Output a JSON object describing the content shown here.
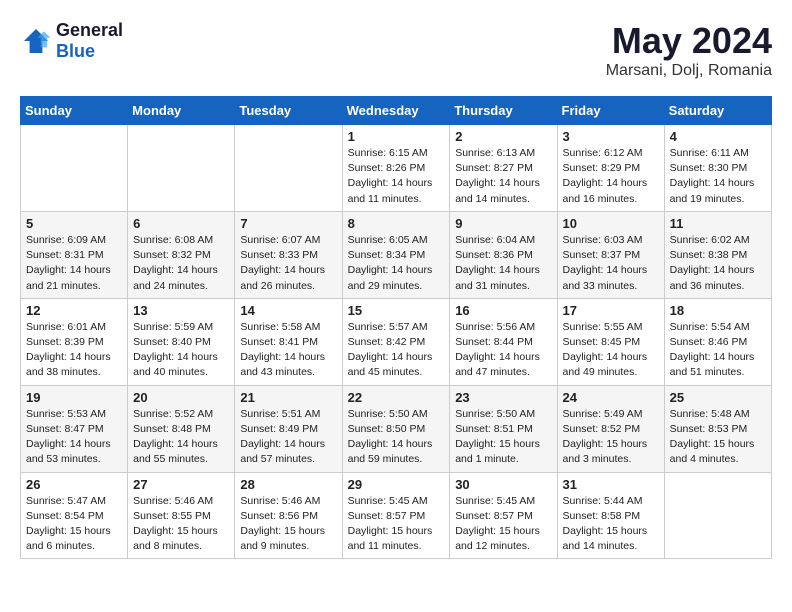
{
  "header": {
    "logo_line1": "General",
    "logo_line2": "Blue",
    "title": "May 2024",
    "subtitle": "Marsani, Dolj, Romania"
  },
  "weekdays": [
    "Sunday",
    "Monday",
    "Tuesday",
    "Wednesday",
    "Thursday",
    "Friday",
    "Saturday"
  ],
  "weeks": [
    [
      {
        "day": "",
        "info": ""
      },
      {
        "day": "",
        "info": ""
      },
      {
        "day": "",
        "info": ""
      },
      {
        "day": "1",
        "info": "Sunrise: 6:15 AM\nSunset: 8:26 PM\nDaylight: 14 hours\nand 11 minutes."
      },
      {
        "day": "2",
        "info": "Sunrise: 6:13 AM\nSunset: 8:27 PM\nDaylight: 14 hours\nand 14 minutes."
      },
      {
        "day": "3",
        "info": "Sunrise: 6:12 AM\nSunset: 8:29 PM\nDaylight: 14 hours\nand 16 minutes."
      },
      {
        "day": "4",
        "info": "Sunrise: 6:11 AM\nSunset: 8:30 PM\nDaylight: 14 hours\nand 19 minutes."
      }
    ],
    [
      {
        "day": "5",
        "info": "Sunrise: 6:09 AM\nSunset: 8:31 PM\nDaylight: 14 hours\nand 21 minutes."
      },
      {
        "day": "6",
        "info": "Sunrise: 6:08 AM\nSunset: 8:32 PM\nDaylight: 14 hours\nand 24 minutes."
      },
      {
        "day": "7",
        "info": "Sunrise: 6:07 AM\nSunset: 8:33 PM\nDaylight: 14 hours\nand 26 minutes."
      },
      {
        "day": "8",
        "info": "Sunrise: 6:05 AM\nSunset: 8:34 PM\nDaylight: 14 hours\nand 29 minutes."
      },
      {
        "day": "9",
        "info": "Sunrise: 6:04 AM\nSunset: 8:36 PM\nDaylight: 14 hours\nand 31 minutes."
      },
      {
        "day": "10",
        "info": "Sunrise: 6:03 AM\nSunset: 8:37 PM\nDaylight: 14 hours\nand 33 minutes."
      },
      {
        "day": "11",
        "info": "Sunrise: 6:02 AM\nSunset: 8:38 PM\nDaylight: 14 hours\nand 36 minutes."
      }
    ],
    [
      {
        "day": "12",
        "info": "Sunrise: 6:01 AM\nSunset: 8:39 PM\nDaylight: 14 hours\nand 38 minutes."
      },
      {
        "day": "13",
        "info": "Sunrise: 5:59 AM\nSunset: 8:40 PM\nDaylight: 14 hours\nand 40 minutes."
      },
      {
        "day": "14",
        "info": "Sunrise: 5:58 AM\nSunset: 8:41 PM\nDaylight: 14 hours\nand 43 minutes."
      },
      {
        "day": "15",
        "info": "Sunrise: 5:57 AM\nSunset: 8:42 PM\nDaylight: 14 hours\nand 45 minutes."
      },
      {
        "day": "16",
        "info": "Sunrise: 5:56 AM\nSunset: 8:44 PM\nDaylight: 14 hours\nand 47 minutes."
      },
      {
        "day": "17",
        "info": "Sunrise: 5:55 AM\nSunset: 8:45 PM\nDaylight: 14 hours\nand 49 minutes."
      },
      {
        "day": "18",
        "info": "Sunrise: 5:54 AM\nSunset: 8:46 PM\nDaylight: 14 hours\nand 51 minutes."
      }
    ],
    [
      {
        "day": "19",
        "info": "Sunrise: 5:53 AM\nSunset: 8:47 PM\nDaylight: 14 hours\nand 53 minutes."
      },
      {
        "day": "20",
        "info": "Sunrise: 5:52 AM\nSunset: 8:48 PM\nDaylight: 14 hours\nand 55 minutes."
      },
      {
        "day": "21",
        "info": "Sunrise: 5:51 AM\nSunset: 8:49 PM\nDaylight: 14 hours\nand 57 minutes."
      },
      {
        "day": "22",
        "info": "Sunrise: 5:50 AM\nSunset: 8:50 PM\nDaylight: 14 hours\nand 59 minutes."
      },
      {
        "day": "23",
        "info": "Sunrise: 5:50 AM\nSunset: 8:51 PM\nDaylight: 15 hours\nand 1 minute."
      },
      {
        "day": "24",
        "info": "Sunrise: 5:49 AM\nSunset: 8:52 PM\nDaylight: 15 hours\nand 3 minutes."
      },
      {
        "day": "25",
        "info": "Sunrise: 5:48 AM\nSunset: 8:53 PM\nDaylight: 15 hours\nand 4 minutes."
      }
    ],
    [
      {
        "day": "26",
        "info": "Sunrise: 5:47 AM\nSunset: 8:54 PM\nDaylight: 15 hours\nand 6 minutes."
      },
      {
        "day": "27",
        "info": "Sunrise: 5:46 AM\nSunset: 8:55 PM\nDaylight: 15 hours\nand 8 minutes."
      },
      {
        "day": "28",
        "info": "Sunrise: 5:46 AM\nSunset: 8:56 PM\nDaylight: 15 hours\nand 9 minutes."
      },
      {
        "day": "29",
        "info": "Sunrise: 5:45 AM\nSunset: 8:57 PM\nDaylight: 15 hours\nand 11 minutes."
      },
      {
        "day": "30",
        "info": "Sunrise: 5:45 AM\nSunset: 8:57 PM\nDaylight: 15 hours\nand 12 minutes."
      },
      {
        "day": "31",
        "info": "Sunrise: 5:44 AM\nSunset: 8:58 PM\nDaylight: 15 hours\nand 14 minutes."
      },
      {
        "day": "",
        "info": ""
      }
    ]
  ]
}
